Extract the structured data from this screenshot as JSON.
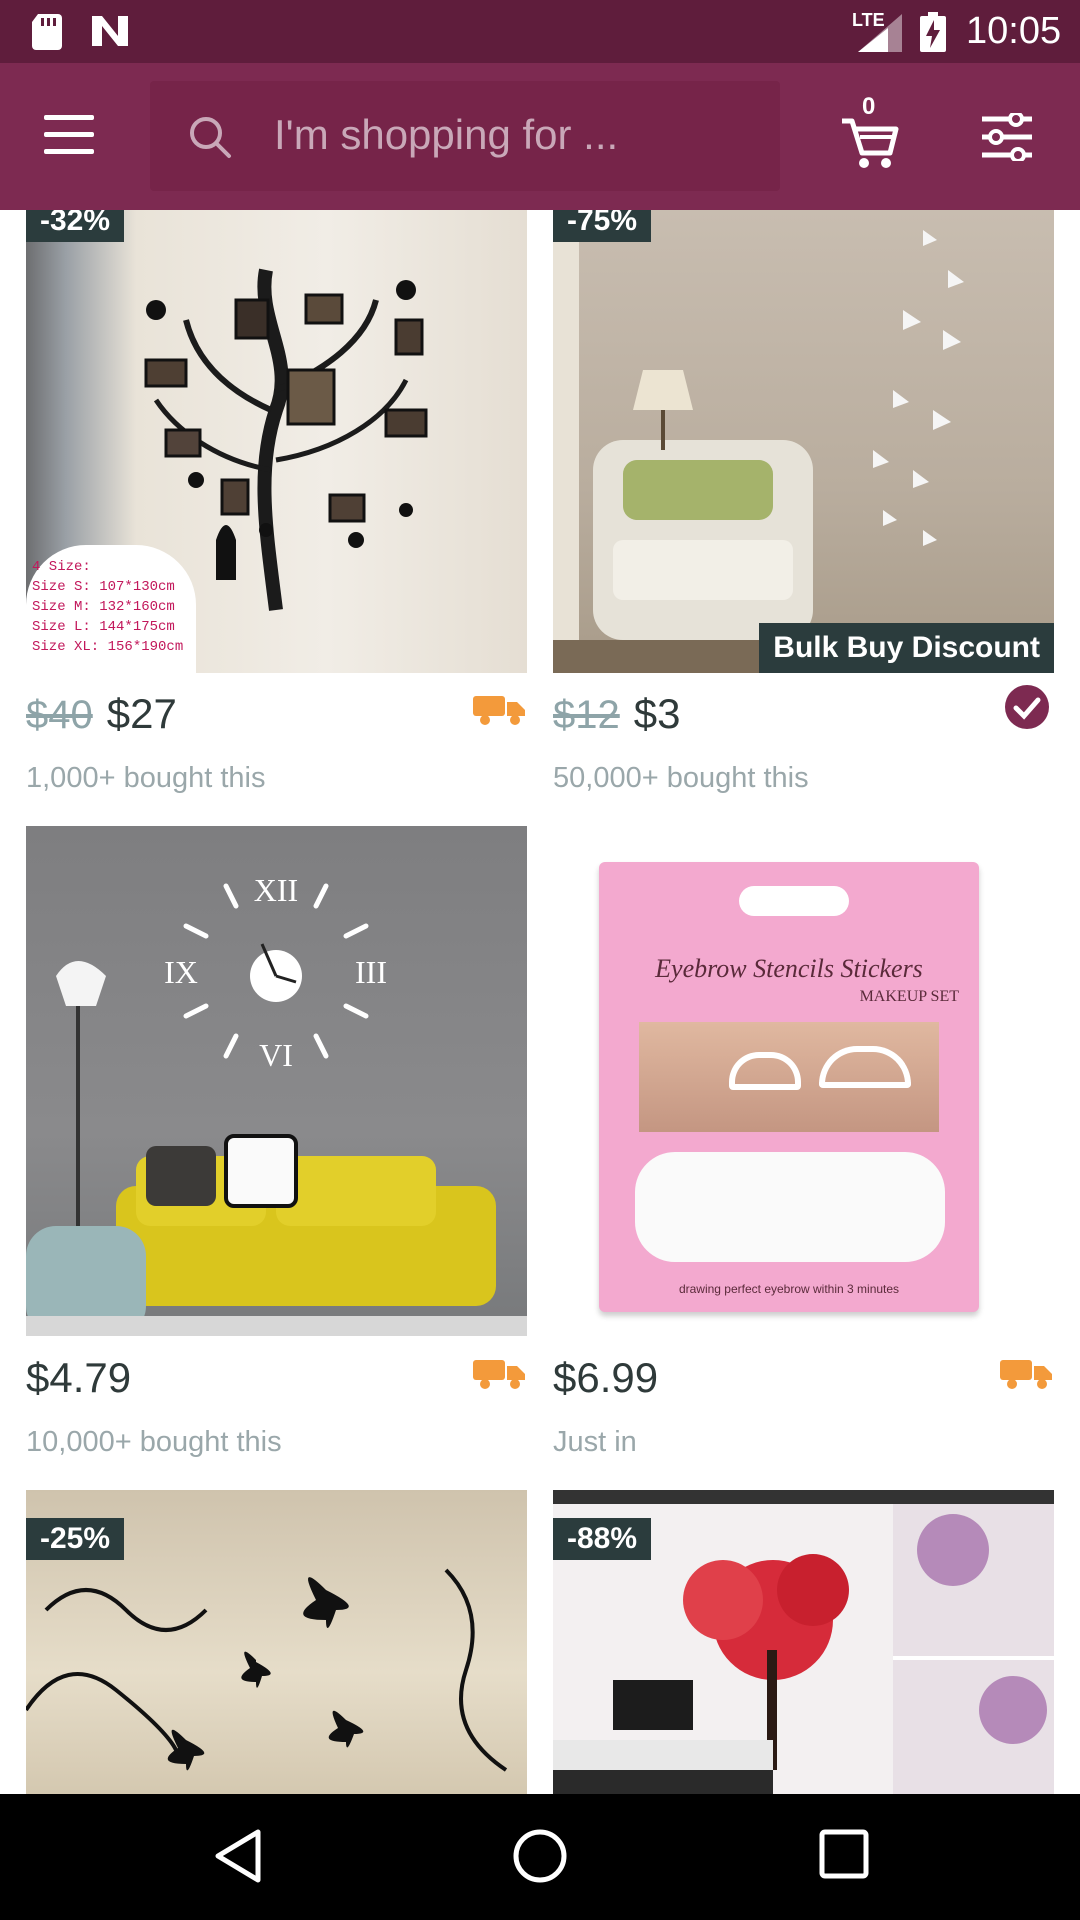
{
  "status_bar": {
    "time": "10:05",
    "network": "LTE"
  },
  "app_bar": {
    "search_placeholder": "I'm shopping for ...",
    "cart_count": "0"
  },
  "products": [
    {
      "discount": "-32%",
      "old_price": "$40",
      "price": "$27",
      "sold": "1,000+ bought this",
      "image_text": "4 Size:\nSize S: 107*130cm\nSize M: 132*160cm\nSize L: 144*175cm\nSize XL: 156*190cm",
      "shipping_icon": "truck-icon"
    },
    {
      "discount": "-75%",
      "old_price": "$12",
      "price": "$3",
      "sold": "50,000+ bought this",
      "tag": "Bulk Buy Discount",
      "verified_icon": "check-circle-icon"
    },
    {
      "price": "$4.79",
      "sold": "10,000+ bought this",
      "shipping_icon": "truck-icon"
    },
    {
      "price": "$6.99",
      "sold": "Just in",
      "image_title": "Eyebrow Stencils Stickers",
      "image_subtitle": "MAKEUP SET",
      "image_caption": "drawing perfect eyebrow within 3 minutes",
      "shipping_icon": "truck-icon"
    },
    {
      "discount": "-25%"
    },
    {
      "discount": "-88%"
    }
  ],
  "colors": {
    "status_bar": "#5f1d3c",
    "app_bar": "#7d2a51",
    "badge": "#2b3c3d",
    "truck": "#f39a3b",
    "check": "#7d2a51"
  }
}
